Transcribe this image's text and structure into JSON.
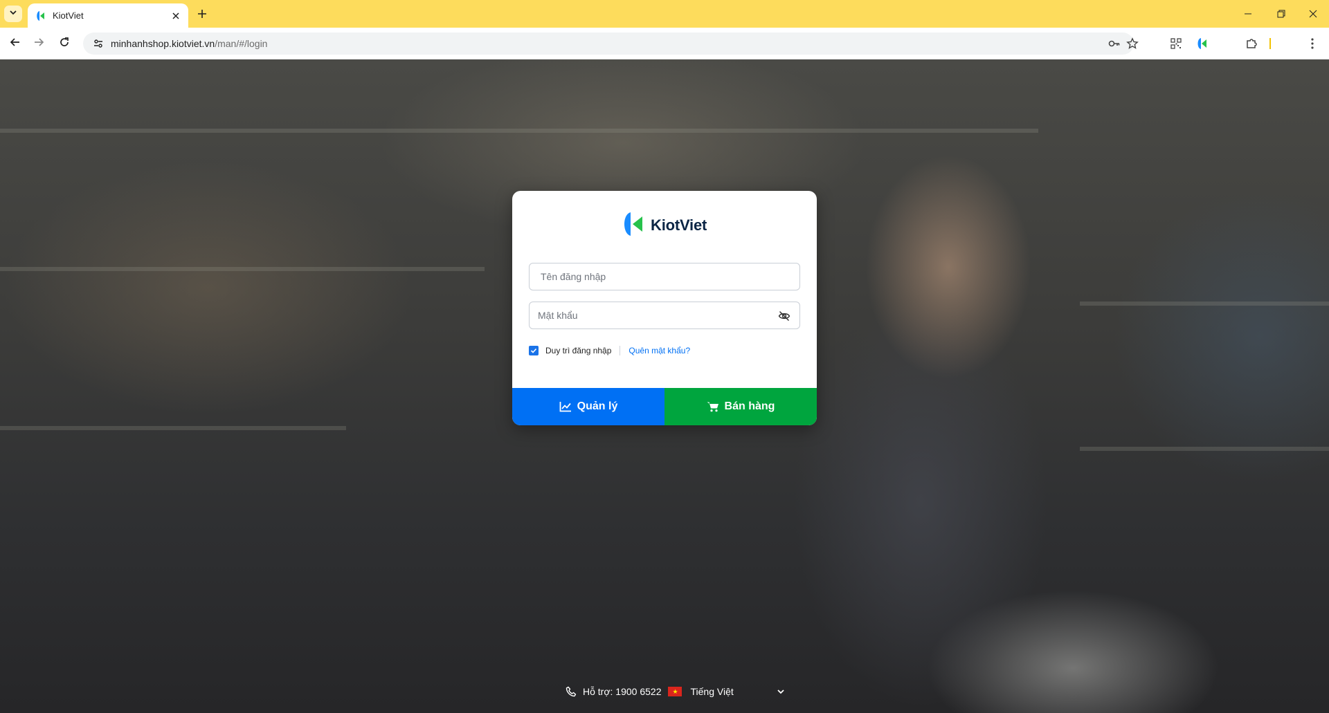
{
  "browser": {
    "tab_title": "KiotViet",
    "url_host": "minhanhshop.kiotviet.vn",
    "url_path": "/man/#/login",
    "accent_color": "#fddc5c"
  },
  "login": {
    "brand_name": "KiotViet",
    "username_placeholder": "Tên đăng nhập",
    "password_placeholder": "Mật khẩu",
    "remember_label": "Duy trì đăng nhập",
    "remember_checked": true,
    "forgot_label": "Quên mật khẩu?",
    "manage_button_label": "Quản lý",
    "sell_button_label": "Bán hàng",
    "colors": {
      "manage": "#0070f4",
      "sell": "#00a53e",
      "brand_text": "#0b2545"
    }
  },
  "footer": {
    "support_text": "Hỗ trợ: 1900 6522",
    "language_label": "Tiếng Việt"
  },
  "icons": {
    "tab_list": "chevron-down-icon",
    "back": "arrow-left-icon",
    "forward": "arrow-right-icon",
    "reload": "reload-icon",
    "site_info": "tune-icon",
    "password_key": "key-icon",
    "bookmark": "star-icon",
    "qr": "qr-code-icon",
    "extension": "puzzle-icon",
    "menu": "kebab-menu-icon",
    "eye": "eye-slash-icon",
    "chart": "chart-line-icon",
    "cart": "cart-icon",
    "phone": "phone-icon",
    "flag": "vietnam-flag-icon"
  }
}
